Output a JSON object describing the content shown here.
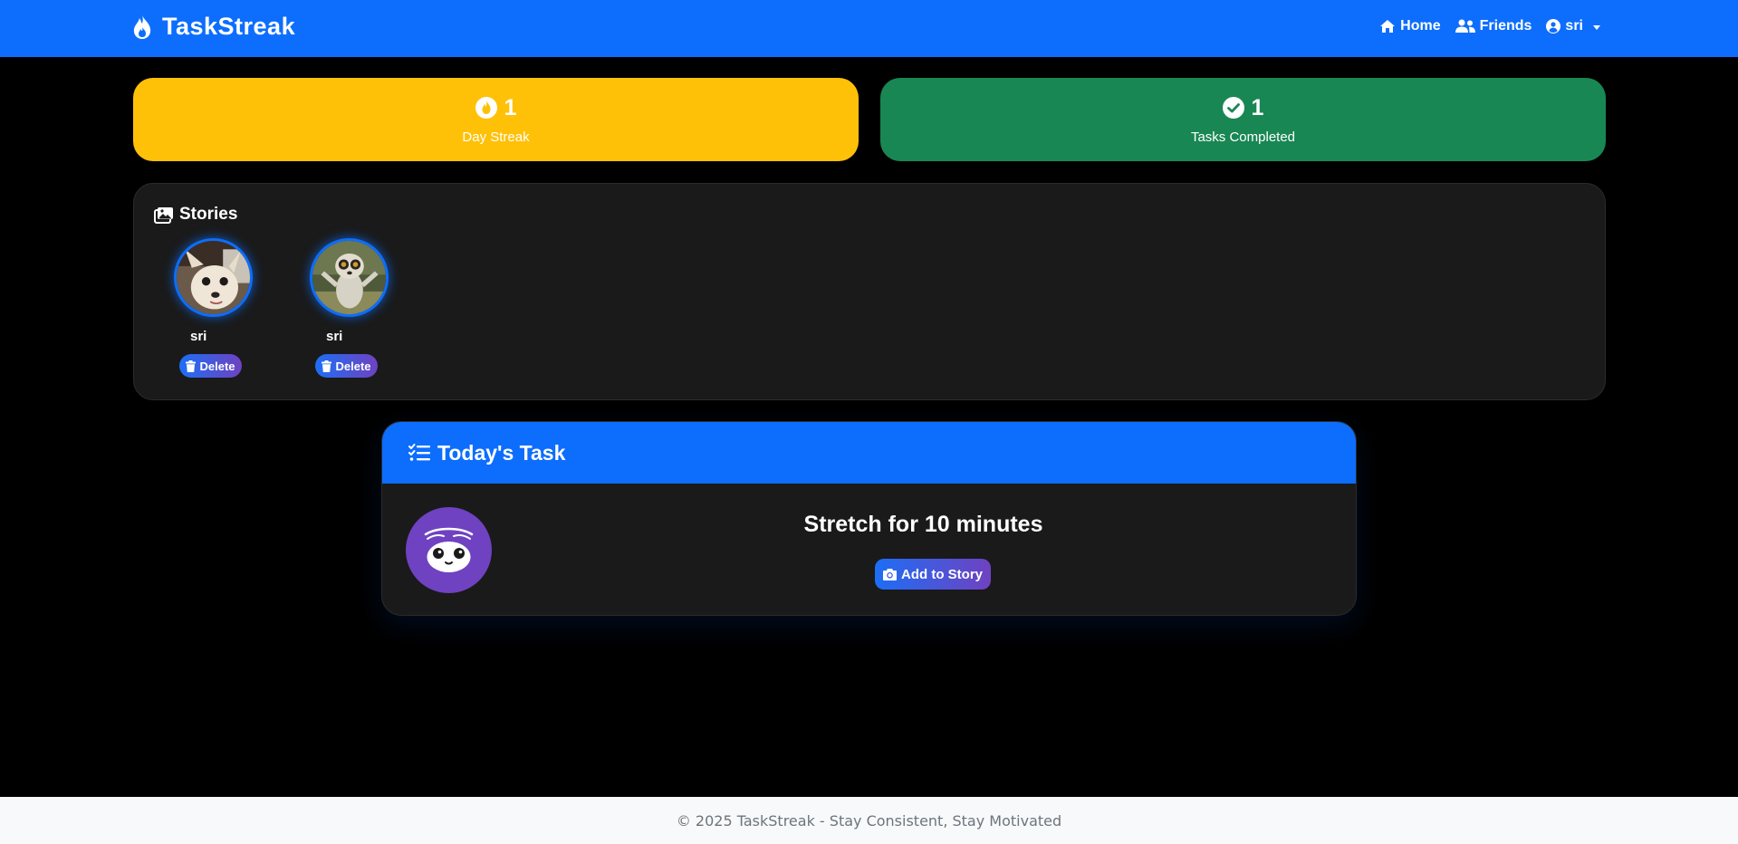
{
  "navbar": {
    "brand": "TaskStreak",
    "brand_icon": "fire-icon",
    "links": {
      "home": "Home",
      "friends": "Friends",
      "user": "sri"
    }
  },
  "stats": {
    "streak": {
      "value": "1",
      "label": "Day Streak",
      "icon": "fire-icon",
      "color": "#ffc107"
    },
    "completed": {
      "value": "1",
      "label": "Tasks Completed",
      "icon": "check-circle-icon",
      "color": "#198754"
    }
  },
  "stories": {
    "title": "Stories",
    "items": [
      {
        "user": "sri",
        "delete_label": "Delete",
        "image": "dog-photo"
      },
      {
        "user": "sri",
        "delete_label": "Delete",
        "image": "lemur-photo"
      }
    ]
  },
  "task": {
    "header": "Today's Task",
    "name": "Stretch for 10 minutes",
    "button": "Add to Story",
    "accent": "#0d6efd"
  },
  "footer": {
    "text": "© 2025 TaskStreak - Stay Consistent, Stay Motivated"
  }
}
